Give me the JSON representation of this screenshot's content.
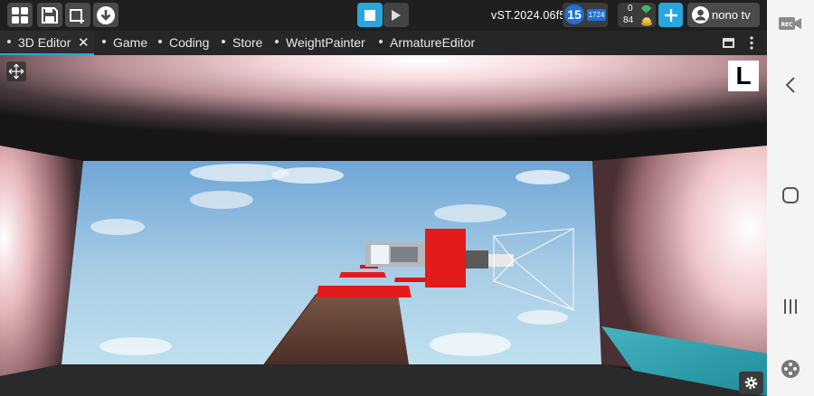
{
  "toolbar": {
    "version": "vST.2024.06f5",
    "level": "15",
    "xp": "1724",
    "gems": "0",
    "gold": "84",
    "user_name": "nono tv",
    "icons": [
      "grid-icon",
      "save-icon",
      "add-object-icon",
      "download-icon",
      "stop-icon",
      "play-icon",
      "plus-icon",
      "user-avatar-icon"
    ],
    "accent_color": "#28a6dd"
  },
  "tabs": [
    {
      "label": "3D Editor",
      "active": true,
      "close": "✕"
    },
    {
      "label": "Game"
    },
    {
      "label": "Coding"
    },
    {
      "label": "Store"
    },
    {
      "label": "WeightPainter"
    },
    {
      "label": "ArmatureEditor"
    }
  ],
  "viewport": {
    "badge": "L"
  },
  "navbar": {
    "rec_label": "REC",
    "icons": [
      "rec-icon",
      "back-icon",
      "home-icon",
      "recents-icon",
      "gamepad-icon"
    ]
  }
}
